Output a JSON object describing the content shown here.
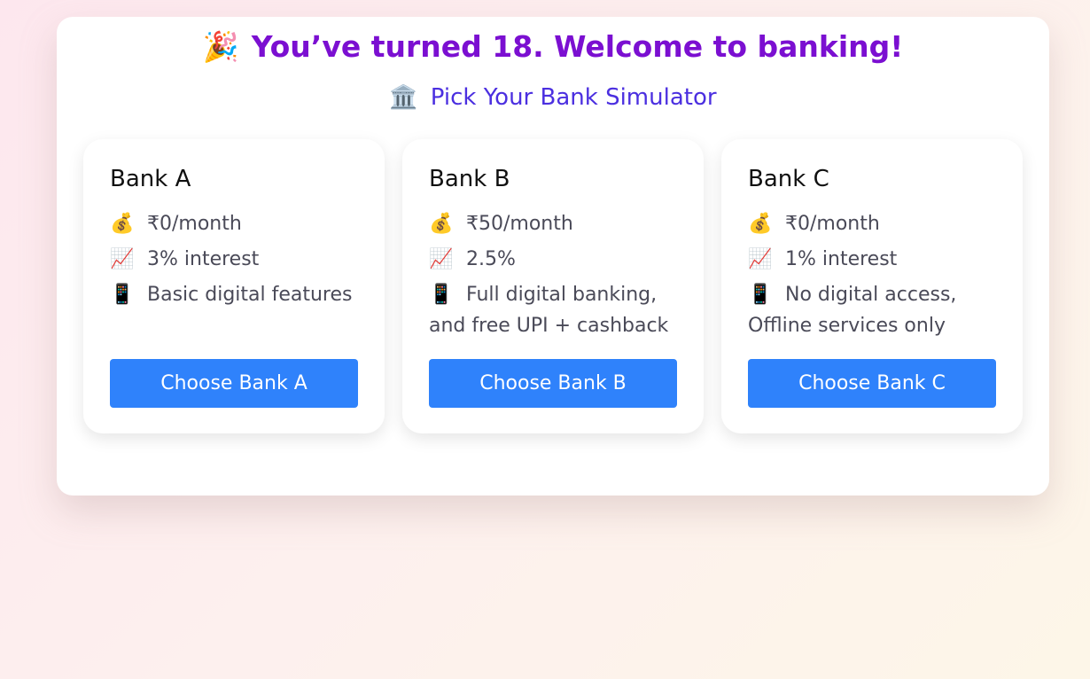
{
  "header": {
    "title_icon": "🎉",
    "title": "You’ve turned 18. Welcome to banking!",
    "subtitle_icon": "🏛️",
    "subtitle": "Pick Your Bank Simulator"
  },
  "icons": {
    "fee": "💰",
    "rate": "📈",
    "digital": "📱"
  },
  "colors": {
    "title": "#7b0fd1",
    "subtitle": "#4b2fe0",
    "button": "#2f82fb"
  },
  "banks": [
    {
      "name": "Bank A",
      "fee": "₹0/month",
      "rate": "3% interest",
      "digital": "Basic digital features",
      "button": "Choose Bank A"
    },
    {
      "name": "Bank B",
      "fee": "₹50/month",
      "rate": "2.5%",
      "digital": "Full digital banking, and free UPI + cashback",
      "button": "Choose Bank B"
    },
    {
      "name": "Bank C",
      "fee": "₹0/month",
      "rate": "1% interest",
      "digital": "No digital access, Offline services only",
      "button": "Choose Bank C"
    }
  ]
}
